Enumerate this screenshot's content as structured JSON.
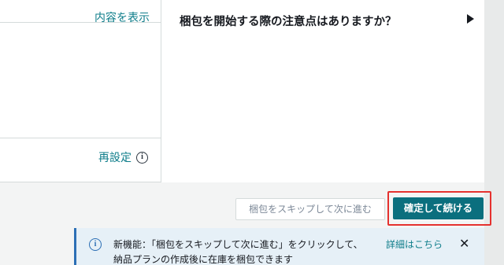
{
  "left_card": {
    "show_content_link": "内容を表示",
    "reset_link": "再設定",
    "reset_info_icon": "info-icon"
  },
  "faq": {
    "title": "梱包を開始する際の注意点はありますか？",
    "caret_icon": "caret-right-icon"
  },
  "actions": {
    "skip_label": "梱包をスキップして次に進む",
    "confirm_label": "確定して続ける",
    "highlight_color": "#e5312e",
    "primary_color": "#0b6f7e"
  },
  "banner": {
    "icon": "info-icon",
    "line1": "新機能：「梱包をスキップして次に進む」をクリックして、",
    "line2": "納品プランの作成後に在庫を梱包できます",
    "link": "詳細はこちら",
    "close_icon": "close-icon",
    "accent_color": "#2c6fb5"
  }
}
